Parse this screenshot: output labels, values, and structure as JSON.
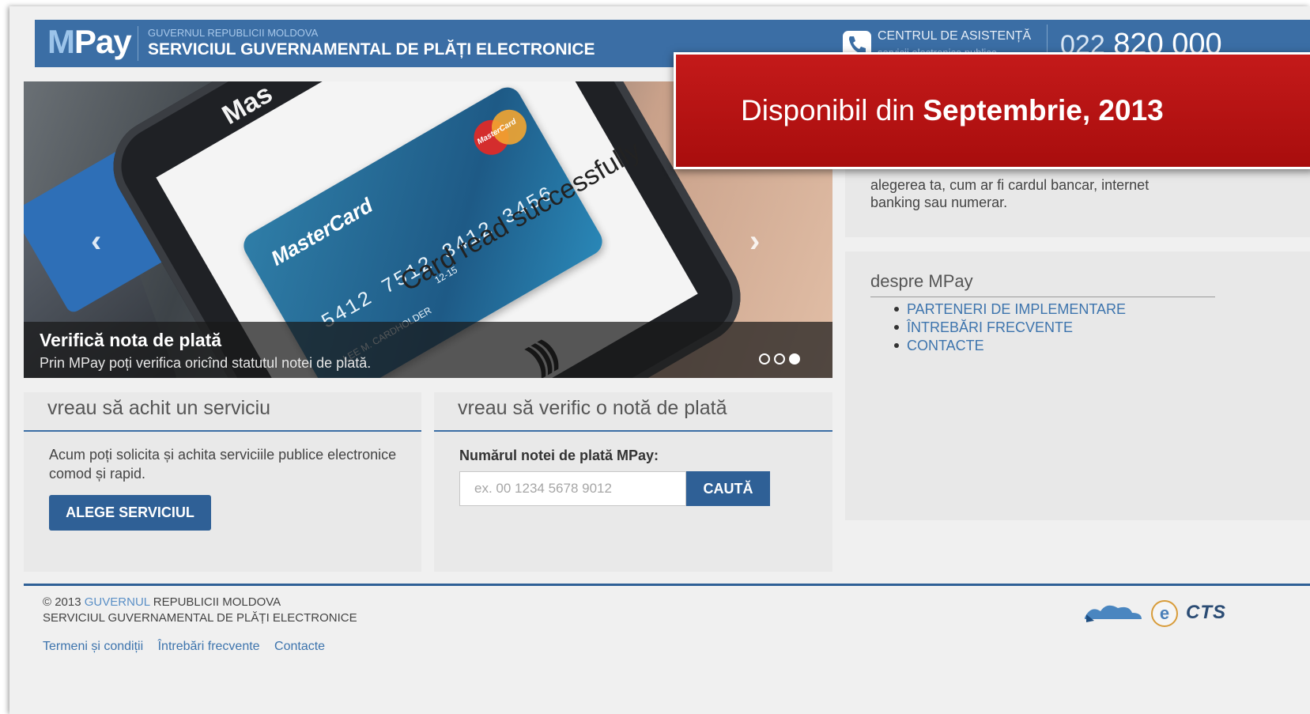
{
  "header": {
    "logo_m": "M",
    "logo_pay": "Pay",
    "gov_small": "GUVERNUL REPUBLICII MOLDOVA",
    "gov_big": "SERVICIUL GUVERNAMENTAL DE PLĂȚI ELECTRONICE",
    "support_title": "CENTRUL DE ASISTENȚĂ",
    "support_sub": "servicii electronice publice",
    "phone_prefix": "022",
    "phone_number": "820 000"
  },
  "banner": {
    "text_regular": "Disponibil din ",
    "text_bold": "Septembrie, 2013"
  },
  "slider": {
    "caption_title": "Verifică nota de plată",
    "caption_text": "Prin MPay poți verifica oricînd statutul notei de plată.",
    "card_brand": "MasterCard",
    "card_number": "5412 7512 3412 3456",
    "card_expiry": "12-15",
    "card_holder": "LEE M. CARDHOLDER",
    "card_logo": "MasterCard",
    "partial_text": "Mas",
    "screen_text": "Card read successfully",
    "dots": 3,
    "active_dot": 3
  },
  "intro": {
    "text": "alegerea ta, cum ar fi cardul bancar, internet banking sau numerar."
  },
  "about": {
    "title": "despre MPay",
    "items": [
      "PARTENERI DE IMPLEMENTARE",
      "ÎNTREBĂRI FRECVENTE",
      "CONTACTE"
    ]
  },
  "pay_box": {
    "title": "vreau să achit un serviciu",
    "text": "Acum poți solicita și achita serviciile publice electronice comod și rapid.",
    "button": "ALEGE SERVICIUL"
  },
  "check_box": {
    "title": "vreau să verific o notă de plată",
    "label": "Numărul notei de plată MPay:",
    "placeholder": "ex. 00 1234 5678 9012",
    "button": "CAUTĂ"
  },
  "footer": {
    "copy_prefix": "© 2013 ",
    "copy_link": "GUVERNUL",
    "copy_suffix": " REPUBLICII MOLDOVA",
    "copy_line2": "SERVICIUL GUVERNAMENTAL DE PLĂȚI ELECTRONICE",
    "links": [
      "Termeni și condiții",
      "Întrebări frecvente",
      "Contacte"
    ],
    "partner_egov": "e",
    "partner_cts": "CTS"
  },
  "colors": {
    "header_blue": "#3b6ea5",
    "button_blue": "#2f6096",
    "banner_red": "#b41414",
    "link_blue": "#3d74ad"
  }
}
